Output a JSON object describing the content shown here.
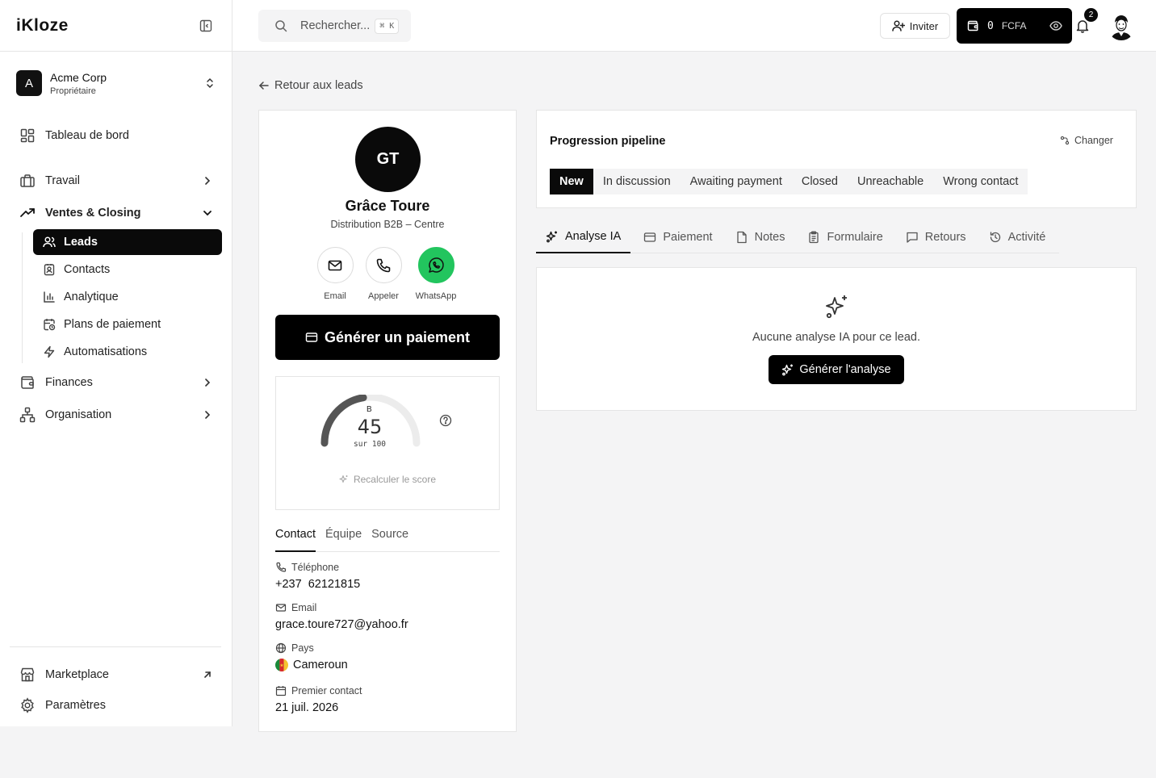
{
  "app": {
    "logo": "iKloze"
  },
  "org": {
    "initial": "A",
    "name": "Acme Corp",
    "role": "Propriétaire"
  },
  "sidebar": {
    "items": [
      {
        "label": "Tableau de bord"
      },
      {
        "label": "Travail"
      },
      {
        "label": "Ventes & Closing"
      },
      {
        "label": "Finances"
      },
      {
        "label": "Organisation"
      }
    ],
    "sub_items": [
      {
        "label": "Leads"
      },
      {
        "label": "Contacts"
      },
      {
        "label": "Analytique"
      },
      {
        "label": "Plans de paiement"
      },
      {
        "label": "Automatisations"
      }
    ],
    "bottom": [
      {
        "label": "Marketplace"
      },
      {
        "label": "Paramètres"
      }
    ]
  },
  "topbar": {
    "search_placeholder": "Rechercher...",
    "shortcut": "⌘ K",
    "invite_label": "Inviter",
    "wallet_amount": "0",
    "wallet_currency": "FCFA",
    "notifications_count": "2"
  },
  "back_label": "Retour aux leads",
  "lead": {
    "initials": "GT",
    "name": "Grâce Toure",
    "company": "Distribution B2B – Centre",
    "actions": [
      {
        "label": "Email"
      },
      {
        "label": "Appeler"
      },
      {
        "label": "WhatsApp"
      }
    ],
    "generate_payment_label": "Générer un paiement",
    "score": {
      "grade": "B",
      "value": "45",
      "max_label": "sur 100",
      "fraction": 0.45,
      "recalc_label": "Recalculer le score"
    },
    "tabs": [
      "Contact",
      "Équipe",
      "Source"
    ],
    "fields": [
      {
        "label": "Téléphone",
        "value": "+237  62121815"
      },
      {
        "label": "Email",
        "value": "grace.toure727@yahoo.fr"
      },
      {
        "label": "Pays",
        "value": "Cameroun"
      },
      {
        "label": "Premier contact",
        "value": "21 juil. 2026"
      }
    ]
  },
  "pipeline": {
    "title": "Progression pipeline",
    "change_label": "Changer",
    "stages": [
      "New",
      "In discussion",
      "Awaiting payment",
      "Closed",
      "Unreachable",
      "Wrong contact"
    ],
    "active_stage": "New"
  },
  "tabs": [
    "Analyse IA",
    "Paiement",
    "Notes",
    "Formulaire",
    "Retours",
    "Activité"
  ],
  "ai": {
    "empty_text": "Aucune analyse IA pour ce lead.",
    "button_label": "Générer l'analyse"
  },
  "colors": {
    "primary": "#0a0a0a",
    "whatsapp": "#22c55e",
    "background": "#f4f4f5"
  }
}
